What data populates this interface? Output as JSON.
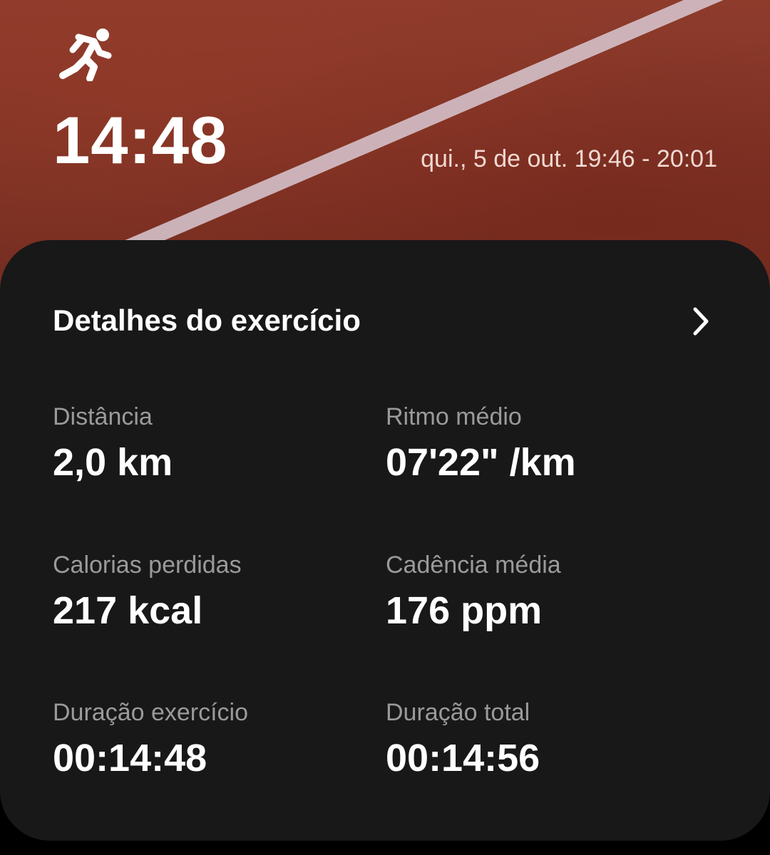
{
  "header": {
    "activity_icon": "running-person-icon",
    "duration_big": "14:48",
    "date_range": "qui., 5 de out. 19:46 - 20:01"
  },
  "details": {
    "title": "Detalhes do exercício",
    "chevron_icon": "chevron-right-icon",
    "stats": {
      "distance": {
        "label": "Distância",
        "value": "2,0 km"
      },
      "avg_pace": {
        "label": "Ritmo médio",
        "value": "07'22\" /km"
      },
      "calories": {
        "label": "Calorias perdidas",
        "value": "217 kcal"
      },
      "avg_cadence": {
        "label": "Cadência média",
        "value": "176 ppm"
      },
      "exercise_duration": {
        "label": "Duração exercício",
        "value": "00:14:48"
      },
      "total_duration": {
        "label": "Duração total",
        "value": "00:14:56"
      }
    }
  },
  "colors": {
    "track": "#8e3b2c",
    "card_bg": "#181818",
    "label_gray": "#9a9a9a",
    "text_white": "#ffffff"
  }
}
